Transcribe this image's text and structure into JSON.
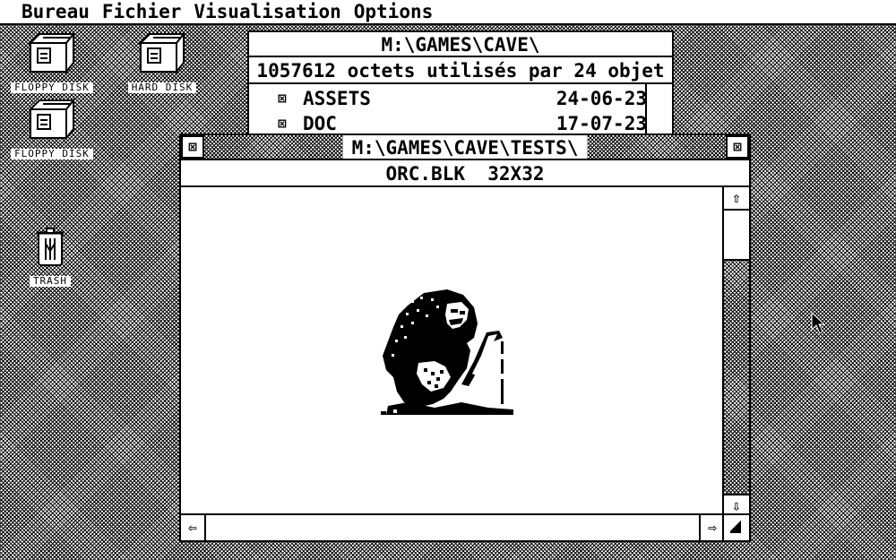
{
  "menubar": {
    "items": [
      "Bureau",
      "Fichier",
      "Visualisation",
      "Options"
    ]
  },
  "desktop": {
    "icons": [
      {
        "label": "FLOPPY DISK",
        "icon": "floppy-drive-icon"
      },
      {
        "label": "HARD DISK",
        "icon": "hard-disk-icon"
      },
      {
        "label": "FLOPPY DISK",
        "icon": "floppy-drive-icon"
      },
      {
        "label": "TRASH",
        "icon": "trash-icon"
      }
    ]
  },
  "back_window": {
    "title": "M:\\GAMES\\CAVE\\",
    "info": "1057612 octets utilisés par 24 objet",
    "files": [
      {
        "name": "ASSETS",
        "date": "24-06-23",
        "icon": "folder-icon"
      },
      {
        "name": "DOC",
        "date": "17-07-23",
        "icon": "folder-icon"
      }
    ]
  },
  "front_window": {
    "title": "M:\\GAMES\\CAVE\\TESTS\\",
    "info": "ORC.BLK  32X32",
    "close_glyph": "⊠",
    "fuller_glyph": "⊠",
    "up_arrow": "⇧",
    "down_arrow": "⇩",
    "left_arrow": "⇦",
    "right_arrow": "⇨",
    "vscroll_position": 0,
    "image": {
      "description_icon": "orc-sprite-image",
      "width": 32,
      "height": 32
    }
  },
  "colors": {
    "foreground": "#000000",
    "background": "#ffffff"
  }
}
